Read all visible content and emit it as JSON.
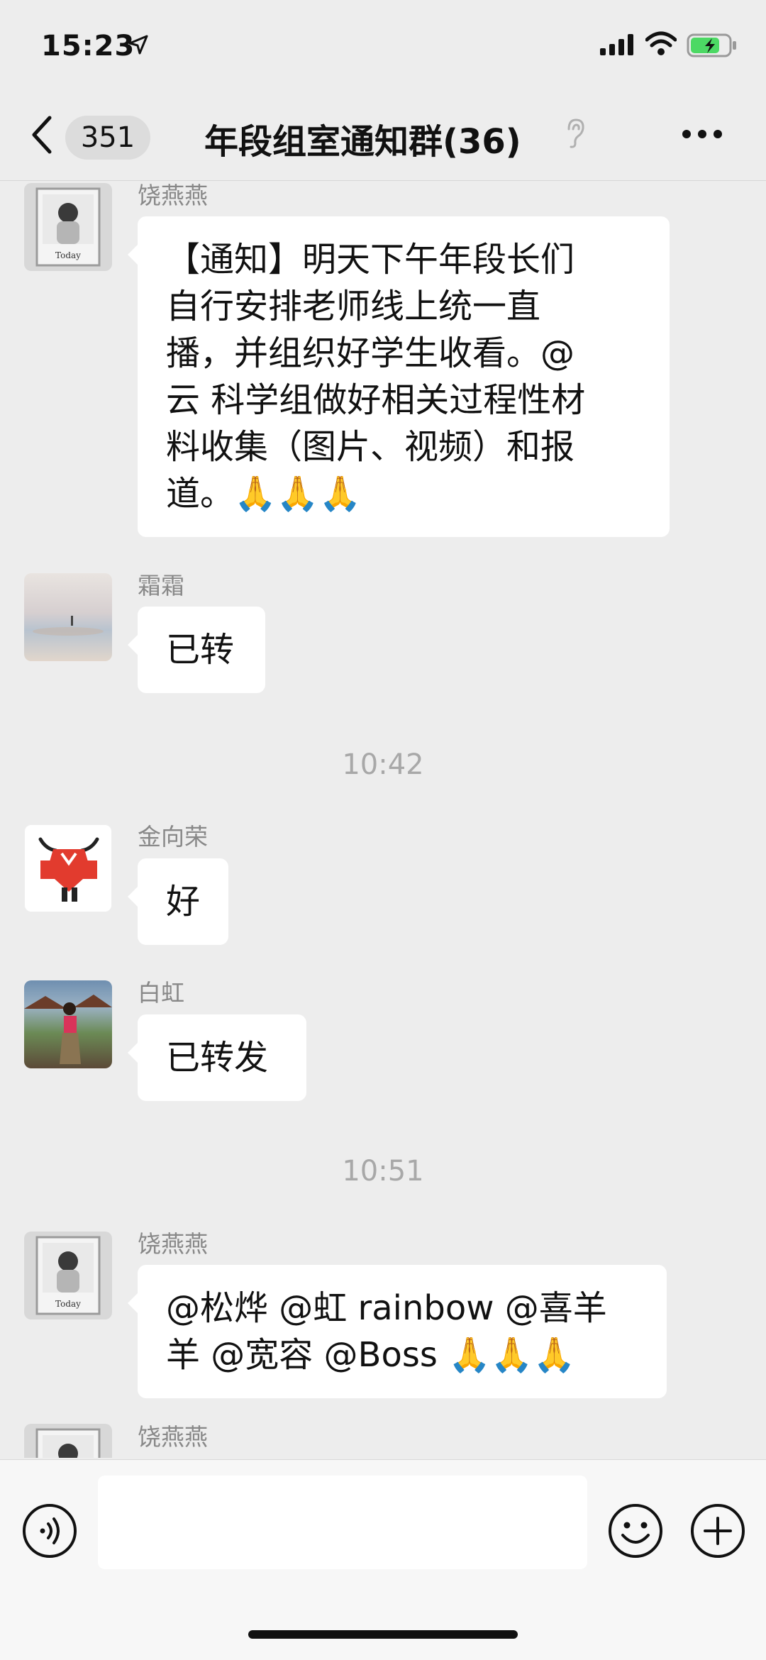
{
  "status_bar": {
    "time": "15:23"
  },
  "nav": {
    "unread_count": "351",
    "title": "年段组室通知群(36)"
  },
  "colors": {
    "background": "#ededed",
    "bubble": "#ffffff",
    "muted": "#888888"
  },
  "messages": [
    {
      "sender": "饶燕燕",
      "text": "【通知】明天下午年段长们\n自行安排老师线上统一直\n播，并组织好学生收看。@\n云 科学组做好相关过程性材\n料收集（图片、视频）和报\n道。🙏🙏🙏"
    },
    {
      "sender": "霜霜",
      "text": "已转"
    },
    {
      "timestamp": "10:42"
    },
    {
      "sender": "金向荣",
      "text": "好"
    },
    {
      "sender": "白虹",
      "text": "已转发"
    },
    {
      "timestamp": "10:51"
    },
    {
      "sender": "饶燕燕",
      "text": "@松烨 @虹 rainbow @喜羊\n羊 @宽容 @Boss 🙏🙏🙏"
    },
    {
      "sender": "饶燕燕"
    }
  ],
  "input": {
    "value": ""
  },
  "icons": [
    "location-arrow-icon",
    "signal-icon",
    "wifi-icon",
    "battery-icon",
    "back-icon",
    "ear-icon",
    "more-icon",
    "voice-icon",
    "emoji-icon",
    "plus-icon"
  ]
}
